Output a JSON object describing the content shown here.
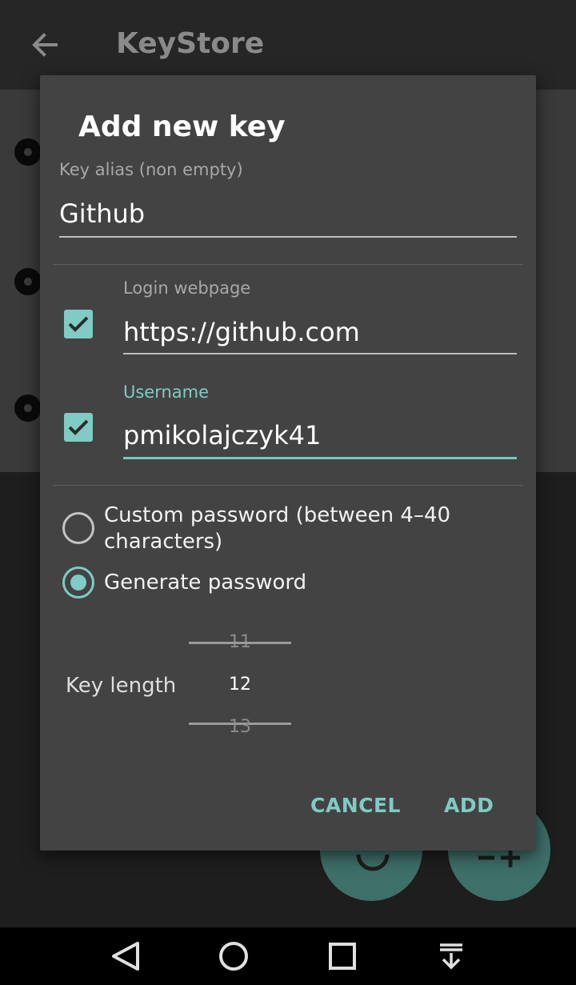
{
  "app": {
    "title": "KeyStore"
  },
  "dialog": {
    "title": "Add new key",
    "alias": {
      "label": "Key alias (non empty)",
      "value": "Github"
    },
    "login": {
      "label": "Login webpage",
      "value": "https://github.com",
      "checked": true
    },
    "username": {
      "label": "Username",
      "value": "pmikolajczyk41",
      "checked": true
    },
    "password_options": [
      {
        "label": "Custom password (between 4–40 characters)",
        "selected": false
      },
      {
        "label": "Generate password",
        "selected": true
      }
    ],
    "key_length": {
      "label": "Key length",
      "prev": "11",
      "current": "12",
      "next": "13"
    },
    "cancel_label": "CANCEL",
    "add_label": "ADD"
  },
  "colors": {
    "accent": "#80cbc4",
    "dialog_bg": "#434343",
    "appbar_bg": "#262626"
  },
  "icons": [
    "back-arrow-icon",
    "checkbox-checked-icon",
    "nav-back-icon",
    "nav-home-icon",
    "nav-recents-icon",
    "nav-menu-icon",
    "refresh-icon",
    "add-remove-icon"
  ]
}
